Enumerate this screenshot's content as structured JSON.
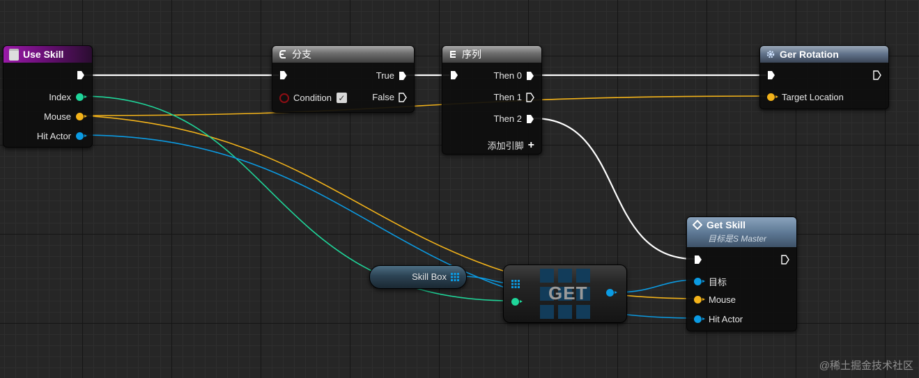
{
  "nodes": {
    "use_skill": {
      "title": "Use Skill",
      "pins": {
        "index": "Index",
        "mouse": "Mouse",
        "hit_actor": "Hit Actor"
      }
    },
    "branch": {
      "title": "分支",
      "pins": {
        "condition": "Condition",
        "true": "True",
        "false": "False"
      }
    },
    "sequence": {
      "title": "序列",
      "pins": {
        "then0": "Then 0",
        "then1": "Then 1",
        "then2": "Then 2",
        "add_pin": "添加引脚"
      }
    },
    "ger_rotation": {
      "title": "Ger Rotation",
      "pins": {
        "target_location": "Target Location"
      }
    },
    "get_skill": {
      "title": "Get Skill",
      "subtitle": "目标是S Master",
      "pins": {
        "target": "目标",
        "mouse": "Mouse",
        "hit_actor": "Hit Actor"
      }
    },
    "skill_box": {
      "label": "Skill Box"
    },
    "get": {
      "label": "GET"
    }
  },
  "colors": {
    "exec_wire": "#ffffff",
    "int_pin": "#1fd69a",
    "vector_pin": "#f3b31a",
    "object_pin": "#0b9be3",
    "bool_pin": "#8e0e14"
  },
  "watermark": "@稀土掘金技术社区"
}
